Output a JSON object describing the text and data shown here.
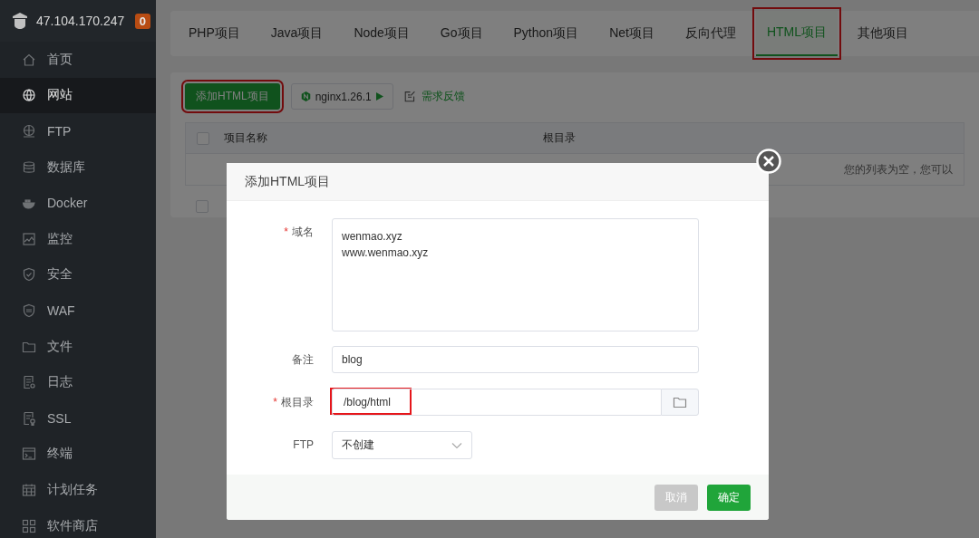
{
  "sidebar": {
    "host": "47.104.170.247",
    "badge": "0",
    "items": [
      {
        "label": "首页",
        "selected": false
      },
      {
        "label": "网站",
        "selected": true
      },
      {
        "label": "FTP",
        "selected": false
      },
      {
        "label": "数据库",
        "selected": false
      },
      {
        "label": "Docker",
        "selected": false
      },
      {
        "label": "监控",
        "selected": false
      },
      {
        "label": "安全",
        "selected": false
      },
      {
        "label": "WAF",
        "selected": false
      },
      {
        "label": "文件",
        "selected": false
      },
      {
        "label": "日志",
        "selected": false
      },
      {
        "label": "SSL",
        "selected": false
      },
      {
        "label": "终端",
        "selected": false
      },
      {
        "label": "计划任务",
        "selected": false
      },
      {
        "label": "软件商店",
        "selected": false
      }
    ]
  },
  "tabs": [
    {
      "label": "PHP项目",
      "selected": false,
      "highlighted": false
    },
    {
      "label": "Java项目",
      "selected": false,
      "highlighted": false
    },
    {
      "label": "Node项目",
      "selected": false,
      "highlighted": false
    },
    {
      "label": "Go项目",
      "selected": false,
      "highlighted": false
    },
    {
      "label": "Python项目",
      "selected": false,
      "highlighted": false
    },
    {
      "label": "Net项目",
      "selected": false,
      "highlighted": false
    },
    {
      "label": "反向代理",
      "selected": false,
      "highlighted": false
    },
    {
      "label": "HTML项目",
      "selected": true,
      "highlighted": true
    },
    {
      "label": "其他项目",
      "selected": false,
      "highlighted": false
    }
  ],
  "toolbar": {
    "add_button": {
      "label": "添加HTML项目",
      "highlighted": true
    },
    "nginx_button": "nginx1.26.1",
    "feedback_link": "需求反馈"
  },
  "table": {
    "select_all_checked": false,
    "columns": [
      "项目名称",
      "根目录"
    ],
    "empty_message": "您的列表为空，您可以",
    "footer_checked": false
  },
  "dialog": {
    "title": "添加HTML项目",
    "fields": [
      {
        "kind": "textarea",
        "required_mark": "*",
        "label": "域名",
        "value": "wenmao.xyz\nwww.wenmao.xyz",
        "highlighted": false
      },
      {
        "kind": "text",
        "label": "备注",
        "value": "blog",
        "highlighted": false
      },
      {
        "kind": "path",
        "required_mark": "*",
        "label": "根目录",
        "value": "/blog/html",
        "highlighted": true
      },
      {
        "kind": "select",
        "label": "FTP",
        "value": "不创建",
        "highlighted": false
      }
    ],
    "buttons": [
      {
        "label": "取消",
        "kind": "cancel"
      },
      {
        "label": "确定",
        "kind": "primary"
      }
    ]
  }
}
